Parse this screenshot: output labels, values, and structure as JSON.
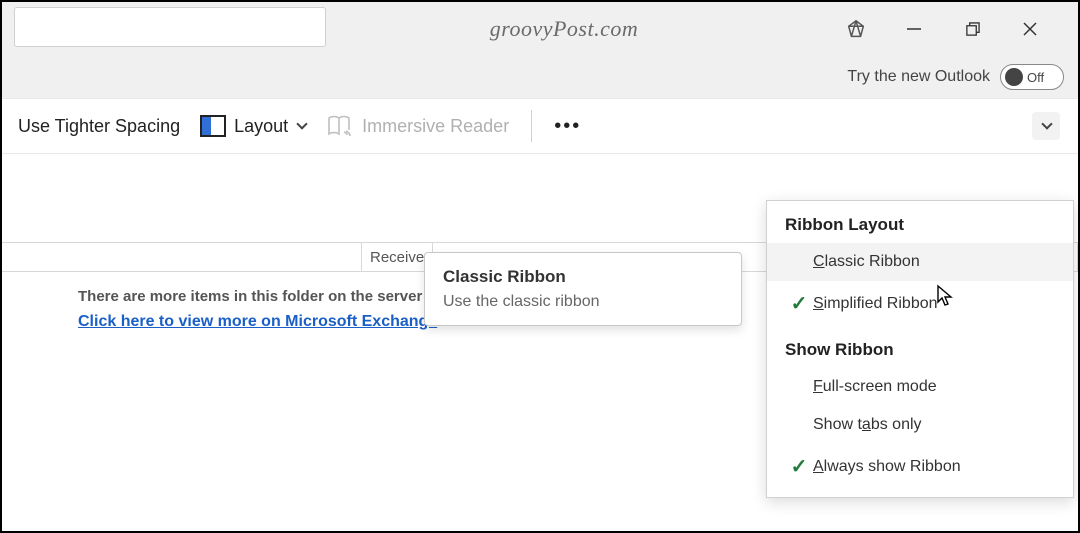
{
  "title": "groovyPost.com",
  "newOutlook": {
    "label": "Try the new Outlook",
    "state": "Off"
  },
  "ribbon": {
    "tighter": "Use Tighter Spacing",
    "layout": "Layout",
    "immersive": "Immersive Reader"
  },
  "columns": {
    "received": "Receive"
  },
  "content": {
    "moreItems": "There are more items in this folder on the server",
    "exchangeLink": "Click here to view more on Microsoft Exchange"
  },
  "tooltip": {
    "title": "Classic Ribbon",
    "desc": "Use the classic ribbon"
  },
  "dropdown": {
    "header1": "Ribbon Layout",
    "classic": "lassic Ribbon",
    "classicPrefix": "C",
    "simplified": "implified Ribbon",
    "simplifiedPrefix": "S",
    "header2": "Show Ribbon",
    "fullscreen": "ull-screen mode",
    "fullscreenPrefix": "F",
    "tabsOnly": "abs only",
    "tabsPrefix": "Show t",
    "tabsOnlySuffix": "",
    "always": "lways show Ribbon",
    "alwaysPrefix": "A"
  }
}
